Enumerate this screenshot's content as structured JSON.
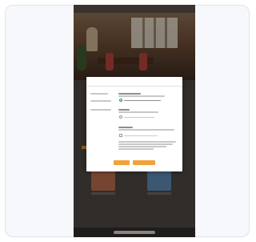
{
  "status_bar": {
    "time": "",
    "signal": ""
  },
  "dialog": {
    "title": "",
    "rows": [
      {
        "label": ""
      },
      {
        "label": ""
      },
      {
        "label": ""
      }
    ],
    "cancel_label": "",
    "confirm_label": ""
  },
  "colors": {
    "accent": "#f0a23c",
    "selected": "#2e9e5b",
    "overlay": "rgba(0,0,0,0.35)"
  }
}
